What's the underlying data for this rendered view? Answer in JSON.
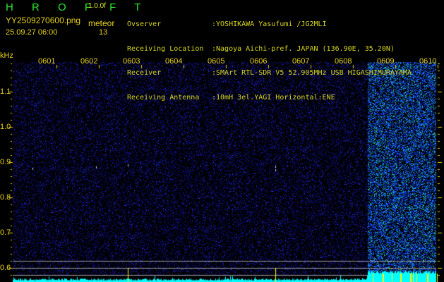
{
  "app": {
    "title": "H R O F F T",
    "version": "1.0.0f"
  },
  "file": {
    "name": "YY2509270600.png",
    "datetime": "25.09.27 06:00"
  },
  "meteor": {
    "label": "meteor",
    "count": "13"
  },
  "info": [
    {
      "label": "Ovserver",
      "value": ":YOSHIKAWA Yasufumi /JG2MLI"
    },
    {
      "label": "Receiving Location",
      "value": ":Nagoya Aichi-pref. JAPAN (136.90E, 35.20N)"
    },
    {
      "label": "Receiver",
      "value": ":SMArt RTL-SDR V5 52.905MHz USB HIGASHIMURAYAMA"
    },
    {
      "label": "Receiving Antenna",
      "value": ":10mH 3el.YAGI Horizontal:ENE"
    }
  ],
  "axis": {
    "unit": "kHz",
    "y_ticks": [
      "1.1",
      "1.0",
      "0.9",
      "0.8",
      "0.7",
      "0.6"
    ],
    "time_labels": [
      "0601",
      "0602",
      "0603",
      "0604",
      "0605",
      "0606",
      "0607",
      "0608",
      "0609",
      "0610"
    ]
  },
  "colors": {
    "noise": "#1a1ad0",
    "hot": "#00ffff",
    "marker": "#ffff00",
    "guide": "#a0a0a0"
  }
}
